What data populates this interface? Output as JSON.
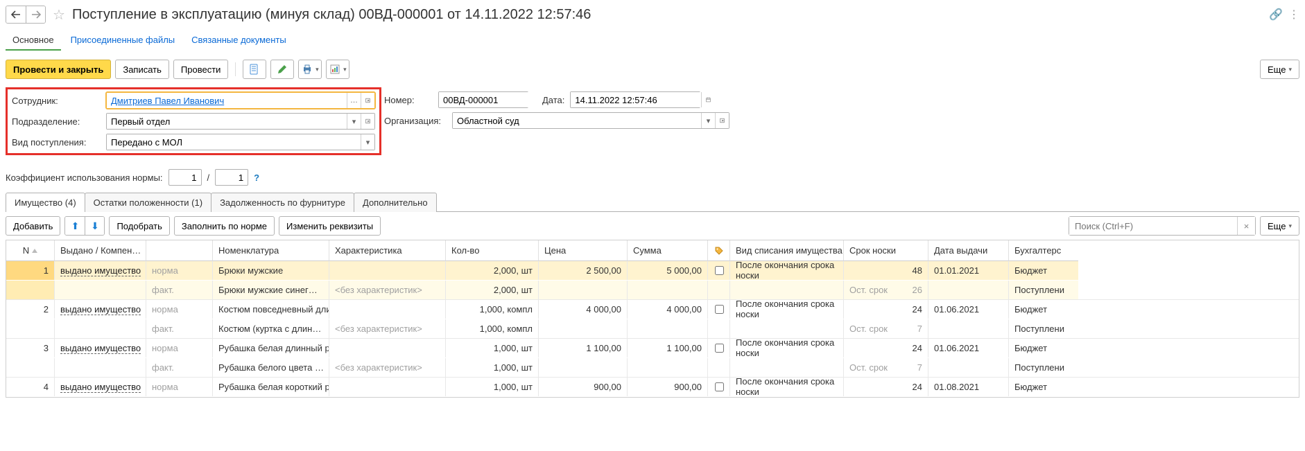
{
  "header": {
    "title": "Поступление в эксплуатацию (минуя склад) 00ВД-000001 от 14.11.2022 12:57:46"
  },
  "mainTabs": {
    "main": "Основное",
    "files": "Присоединенные файлы",
    "related": "Связанные документы"
  },
  "toolbar": {
    "post_close": "Провести и закрыть",
    "save": "Записать",
    "post": "Провести",
    "more": "Еще"
  },
  "form": {
    "employee_label": "Сотрудник:",
    "employee_value": "Дмитриев Павел Иванович",
    "department_label": "Подразделение:",
    "department_value": "Первый отдел",
    "receipt_type_label": "Вид поступления:",
    "receipt_type_value": "Передано с МОЛ",
    "number_label": "Номер:",
    "number_value": "00ВД-000001",
    "date_label": "Дата:",
    "date_value": "14.11.2022 12:57:46",
    "org_label": "Организация:",
    "org_value": "Областной суд",
    "coef_label": "Коэффициент использования нормы:",
    "coef_num": "1",
    "coef_den": "1"
  },
  "gridTabs": {
    "property": "Имущество (4)",
    "remains": "Остатки положенности (1)",
    "debt": "Задолженность по фурнитуре",
    "additional": "Дополнительно"
  },
  "gridToolbar": {
    "add": "Добавить",
    "pick": "Подобрать",
    "fill_norm": "Заполнить по норме",
    "edit_props": "Изменить реквизиты",
    "search_placeholder": "Поиск (Ctrl+F)",
    "more": "Еще"
  },
  "columns": {
    "n": "N",
    "issued": "Выдано / Компен…",
    "nom": "Номенклатура",
    "char": "Характеристика",
    "qty": "Кол-во",
    "price": "Цена",
    "sum": "Сумма",
    "writeoff": "Вид списания имущества",
    "term": "Срок носки",
    "date": "Дата выдачи",
    "src": "Бухгалтерс"
  },
  "labels": {
    "norm": "норма",
    "fact": "факт.",
    "issued_item": "выдано имущество",
    "rest_term": "Ост. срок",
    "no_char": "<без характеристик>"
  },
  "rows": [
    {
      "n": "1",
      "nom_norm": "Брюки мужские",
      "nom_fact": "Брюки  мужские синег…",
      "qty_norm": "2,000, шт",
      "qty_fact": "2,000, шт",
      "price": "2 500,00",
      "sum": "5 000,00",
      "writeoff": "После окончания срока носки",
      "term": "48",
      "rest": "26",
      "date": "01.01.2021",
      "src_norm": "Бюджет",
      "src_fact": "Поступлени"
    },
    {
      "n": "2",
      "nom_norm": "Костюм повседневный длинный рукав",
      "nom_fact": "Костюм (куртка с длин…",
      "qty_norm": "1,000, компл",
      "qty_fact": "1,000, компл",
      "price": "4 000,00",
      "sum": "4 000,00",
      "writeoff": "После окончания срока носки",
      "term": "24",
      "rest": "7",
      "date": "01.06.2021",
      "src_norm": "Бюджет",
      "src_fact": "Поступлени"
    },
    {
      "n": "3",
      "nom_norm": "Рубашка белая длинный рукав",
      "nom_fact": "Рубашка белого цвета …",
      "qty_norm": "1,000, шт",
      "qty_fact": "1,000, шт",
      "price": "1 100,00",
      "sum": "1 100,00",
      "writeoff": "После окончания срока носки",
      "term": "24",
      "rest": "7",
      "date": "01.06.2021",
      "src_norm": "Бюджет",
      "src_fact": "Поступлени"
    },
    {
      "n": "4",
      "nom_norm": "Рубашка белая короткий рукав",
      "nom_fact": "",
      "qty_norm": "1,000, шт",
      "qty_fact": "",
      "price": "900,00",
      "sum": "900,00",
      "writeoff": "После окончания срока носки",
      "term": "24",
      "rest": "",
      "date": "01.08.2021",
      "src_norm": "Бюджет",
      "src_fact": ""
    }
  ]
}
